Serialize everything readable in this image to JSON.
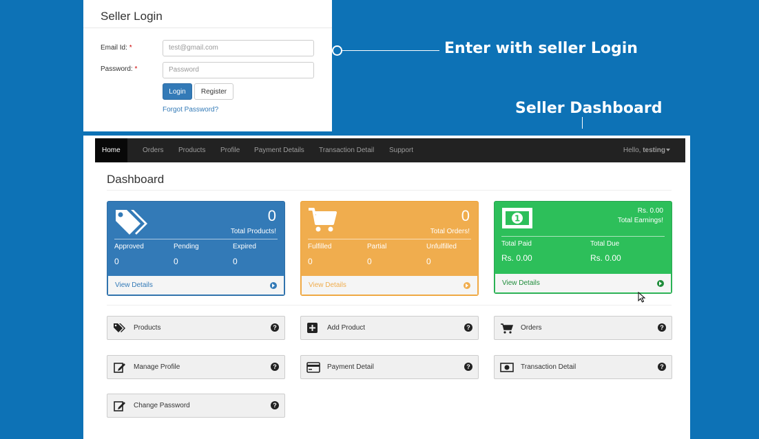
{
  "login": {
    "title": "Seller Login",
    "email_label": "Email Id:",
    "password_label": "Password:",
    "required_mark": "*",
    "email_value": "test@gmail.com",
    "password_placeholder": "Password",
    "login_button": "Login",
    "register_button": "Register",
    "forgot_link": "Forgot Password?"
  },
  "annotations": {
    "login_caption": "Enter with seller Login",
    "dashboard_caption": "Seller Dashboard"
  },
  "navbar": {
    "items": [
      "Home",
      "Orders",
      "Products",
      "Profile",
      "Payment Details",
      "Transaction Detail",
      "Support"
    ],
    "greeting": "Hello,",
    "username": "testing"
  },
  "dashboard": {
    "title": "Dashboard",
    "products_card": {
      "count": "0",
      "caption": "Total Products!",
      "subs": [
        {
          "label": "Approved",
          "value": "0"
        },
        {
          "label": "Pending",
          "value": "0"
        },
        {
          "label": "Expired",
          "value": "0"
        }
      ],
      "footer": "View Details",
      "color": "#337ab7"
    },
    "orders_card": {
      "count": "0",
      "caption": "Total Orders!",
      "subs": [
        {
          "label": "Fulfilled",
          "value": "0"
        },
        {
          "label": "Partial",
          "value": "0"
        },
        {
          "label": "Unfulfilled",
          "value": "0"
        }
      ],
      "footer": "View Details",
      "color": "#f0ad4e"
    },
    "earnings_card": {
      "count": "Rs. 0.00",
      "caption": "Total Earnings!",
      "subs": [
        {
          "label": "Total Paid",
          "value": "Rs. 0.00"
        },
        {
          "label": "Total Due",
          "value": "Rs. 0.00"
        }
      ],
      "footer": "View Details",
      "color": "#2dbf5a"
    },
    "tiles": [
      {
        "label": "Products",
        "icon": "tags-icon"
      },
      {
        "label": "Add Product",
        "icon": "plus-square-icon"
      },
      {
        "label": "Orders",
        "icon": "cart-icon"
      },
      {
        "label": "Manage Profile",
        "icon": "edit-icon"
      },
      {
        "label": "Payment Detail",
        "icon": "credit-card-icon"
      },
      {
        "label": "Transaction Detail",
        "icon": "money-icon"
      },
      {
        "label": "Change Password",
        "icon": "edit-icon"
      }
    ],
    "help_glyph": "?"
  }
}
